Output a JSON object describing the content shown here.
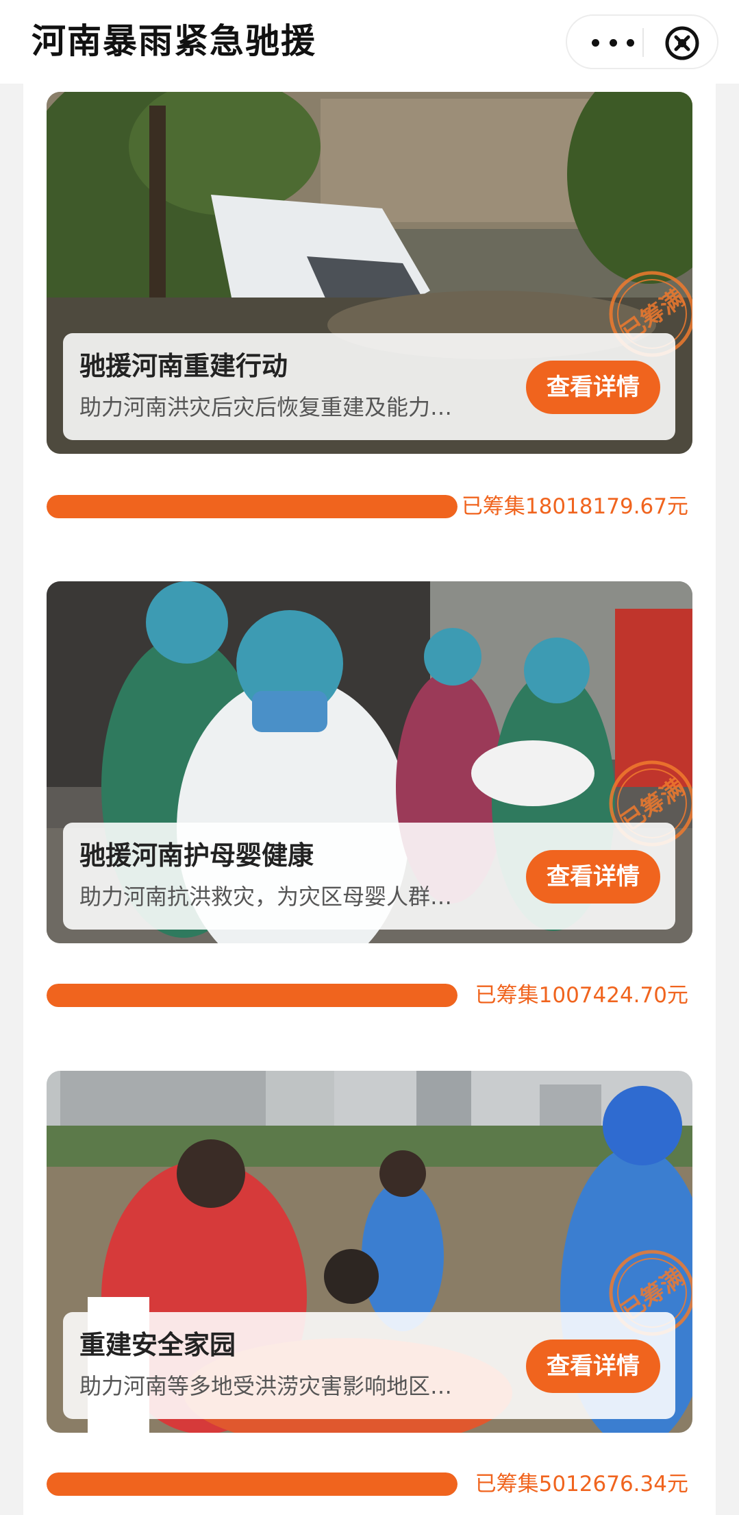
{
  "header": {
    "title": "河南暴雨紧急驰援",
    "more_icon": "more-dots-icon",
    "close_icon": "close-circle-icon"
  },
  "colors": {
    "accent": "#f0641e",
    "progress_track": "#e8e8e8"
  },
  "projects": [
    {
      "name": "驰援河南重建行动",
      "description": "助力河南洪灾后灾后恢复重建及能力…",
      "button_label": "查看详情",
      "stamp_text": "已筹满",
      "raised_label": "已筹集18018179.67元",
      "progress": 1.0,
      "photo": "flood-damaged-vehicle-photo"
    },
    {
      "name": "驰援河南护母婴健康",
      "description": "助力河南抗洪救灾，为灾区母婴人群…",
      "button_label": "查看详情",
      "stamp_text": "已筹满",
      "raised_label": "已筹集1007424.70元",
      "progress": 1.0,
      "photo": "medical-staff-carrying-newborns-photo"
    },
    {
      "name": "重建安全家园",
      "description": "助力河南等多地受洪涝灾害影响地区…",
      "button_label": "查看详情",
      "stamp_text": "已筹满",
      "raised_label": "已筹集5012676.34元",
      "progress": 1.0,
      "photo": "rescue-boat-flooded-street-photo"
    }
  ]
}
